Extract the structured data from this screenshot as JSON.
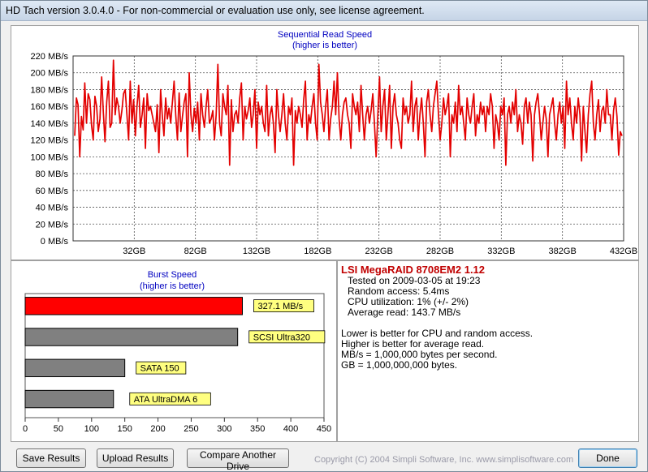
{
  "window": {
    "title": "HD Tach version 3.0.4.0  - For non-commercial or evaluation use only, see license agreement."
  },
  "colors": {
    "read_line": "#e30000",
    "bar_primary": "#ff0000",
    "bar_other": "#808080",
    "label_bg": "#ffff80",
    "title_blue": "#0000c0",
    "drive_name": "#c00000"
  },
  "chart_data": [
    {
      "type": "line",
      "title": "Sequential Read Speed",
      "subtitle": "(higher is better)",
      "ylim": [
        0,
        220
      ],
      "yticks": [
        "0 MB/s",
        "20 MB/s",
        "40 MB/s",
        "60 MB/s",
        "80 MB/s",
        "100 MB/s",
        "120 MB/s",
        "140 MB/s",
        "160 MB/s",
        "180 MB/s",
        "200 MB/s",
        "220 MB/s"
      ],
      "xlim": [
        0,
        432
      ],
      "xticks": [
        "32GB",
        "82GB",
        "132GB",
        "182GB",
        "232GB",
        "282GB",
        "332GB",
        "382GB",
        "432GB"
      ],
      "grid": true,
      "series": [
        {
          "values": [
            125,
            170,
            162,
            100,
            148,
            132,
            188,
            140,
            175,
            168,
            138,
            120,
            172,
            160,
            130,
            145,
            195,
            152,
            118,
            165,
            190,
            135,
            140,
            215,
            150,
            170,
            160,
            140,
            155,
            175,
            180,
            150,
            120,
            190,
            140,
            168,
            125,
            160,
            185,
            135,
            150,
            170,
            110,
            175,
            155,
            160,
            150,
            140,
            130,
            162,
            105,
            180,
            150,
            125,
            170,
            145,
            158,
            140,
            165,
            190,
            150,
            120,
            176,
            130,
            148,
            165,
            175,
            100,
            200,
            150,
            130,
            158,
            140,
            165,
            120,
            175,
            150,
            135,
            160,
            180,
            140,
            145,
            155,
            120,
            150,
            210,
            140,
            125,
            175,
            160,
            150,
            185,
            90,
            168,
            130,
            150,
            155,
            140,
            170,
            188,
            120,
            160,
            145,
            155,
            170,
            135,
            150,
            180,
            110,
            165,
            150,
            160,
            140,
            130,
            185,
            125,
            150,
            160,
            140,
            105,
            180,
            150,
            130,
            150,
            175,
            140,
            120,
            160,
            150,
            170,
            90,
            155,
            140,
            160,
            150,
            135,
            168,
            190,
            120,
            150,
            140,
            160,
            175,
            140,
            120,
            210,
            165,
            150,
            130,
            160,
            180,
            120,
            145,
            160,
            190,
            150,
            200,
            145,
            120,
            150,
            165,
            170,
            150,
            140,
            110,
            175,
            160,
            150,
            165,
            130,
            185,
            150,
            120,
            150,
            160,
            140,
            155,
            175,
            140,
            100,
            150,
            195,
            130,
            160,
            180,
            120,
            150,
            185,
            110,
            160,
            175,
            150,
            140,
            120,
            110,
            170,
            150,
            160,
            140,
            150,
            190,
            130,
            160,
            170,
            120,
            150,
            170,
            140,
            100,
            165,
            180,
            150,
            130,
            160,
            175,
            190,
            150,
            120,
            140,
            170,
            150,
            160,
            175,
            100,
            150,
            140,
            165,
            130,
            185,
            150,
            160,
            140,
            120,
            170,
            150,
            140,
            160,
            175,
            125,
            150,
            140,
            165,
            150,
            160,
            130,
            160,
            150,
            175,
            160,
            110,
            150,
            140,
            120,
            160,
            150,
            170,
            90,
            150,
            160,
            140,
            165,
            150,
            180,
            130,
            150,
            140,
            115,
            160,
            170,
            140,
            165,
            150,
            95,
            150,
            165,
            175,
            150,
            120,
            140,
            160,
            145,
            100,
            150,
            160,
            170,
            140,
            120,
            150,
            165,
            140,
            160,
            110,
            190,
            150,
            170,
            140,
            120,
            160,
            140,
            170,
            150,
            95,
            160,
            130,
            105,
            150,
            175,
            190,
            140,
            120,
            150,
            168,
            130,
            155,
            160,
            140,
            180,
            150,
            150,
            120,
            155,
            170,
            148,
            102,
            130,
            125
          ]
        }
      ]
    },
    {
      "type": "bar",
      "orientation": "horizontal",
      "title": "Burst Speed",
      "subtitle": "(higher is better)",
      "xlim": [
        0,
        450
      ],
      "xticks": [
        "0",
        "50",
        "100",
        "150",
        "200",
        "250",
        "300",
        "350",
        "400",
        "450"
      ],
      "categories": [
        "327.1 MB/s",
        "SCSI Ultra320",
        "SATA 150",
        "ATA UltraDMA 6"
      ],
      "values": [
        327.1,
        320,
        150,
        133
      ]
    }
  ],
  "info": {
    "drive_name": "LSI MegaRAID 8708EM2 1.12",
    "tested": "Tested on 2009-03-05 at 19:23",
    "random_access": "Random access: 5.4ms",
    "cpu": "CPU utilization: 1% (+/- 2%)",
    "avg_read": "Average read: 143.7 MB/s",
    "note1": "Lower is better for CPU and random access.",
    "note2": "Higher is better for average read.",
    "note3": "MB/s = 1,000,000 bytes per second.",
    "note4": "GB = 1,000,000,000 bytes."
  },
  "buttons": {
    "save": "Save Results",
    "upload": "Upload Results",
    "compare": "Compare Another Drive",
    "done": "Done"
  },
  "copyright": "Copyright (C) 2004 Simpli Software, Inc. www.simplisoftware.com"
}
